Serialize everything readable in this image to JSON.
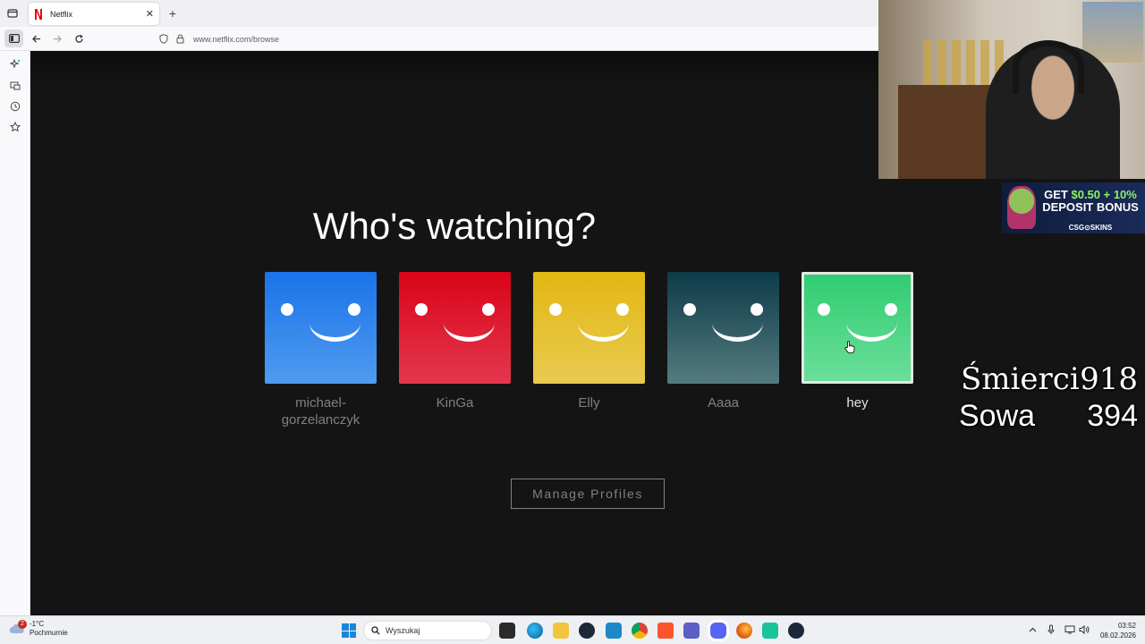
{
  "browser": {
    "tab_title": "Netflix",
    "tab_close": "✕",
    "new_tab": "+",
    "url": "www.netflix.com/browse"
  },
  "page": {
    "title": "Who's watching?",
    "manage_profiles": "Manage Profiles"
  },
  "profiles": [
    {
      "name_line1": "michael-",
      "name_line2": "gorzelanczyk",
      "color_top": "#1a73e8",
      "color_bottom": "#4f9bf0"
    },
    {
      "name_line1": "KinGa",
      "name_line2": "",
      "color_top": "#d90417",
      "color_bottom": "#e4374f"
    },
    {
      "name_line1": "Elly",
      "name_line2": "",
      "color_top": "#e2b713",
      "color_bottom": "#e9ca50"
    },
    {
      "name_line1": "Aaaa",
      "name_line2": "",
      "color_top": "#0c3b48",
      "color_bottom": "#557b80"
    },
    {
      "name_line1": "hey",
      "name_line2": "",
      "color_top": "#2ecc71",
      "color_bottom": "#6ddf9a",
      "selected": true
    }
  ],
  "ad": {
    "line1_a": "GET ",
    "line1_b": "$0.50 + 10%",
    "line2": "DEPOSIT BONUS",
    "brand": "CSG⊙SKINS"
  },
  "counter": {
    "deaths_label": "Śmierci",
    "deaths_value": "918",
    "sowa_label": "Sowa",
    "sowa_value": "394"
  },
  "taskbar": {
    "weather_temp": "-1°C",
    "weather_desc": "Pochmurnie",
    "weather_badge": "2",
    "search_placeholder": "Wyszukaj",
    "time": "03:52",
    "date": "08.02.2026"
  },
  "colors": {
    "netflix_bg": "#141414",
    "netflix_red": "#e50914"
  }
}
